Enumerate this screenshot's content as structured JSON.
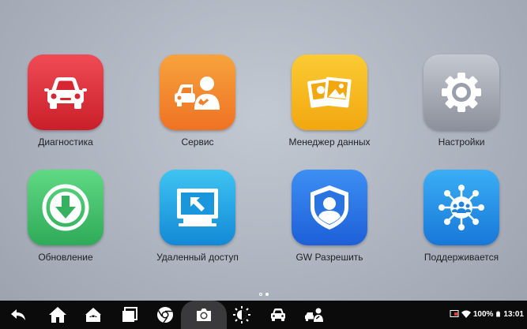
{
  "apps": [
    {
      "label": "Диагностика",
      "icon": "car-icon",
      "color": "#e8323c"
    },
    {
      "label": "Сервис",
      "icon": "car-service-person-icon",
      "color": "#f38a2e"
    },
    {
      "label": "Менеджер данных",
      "icon": "photos-icon",
      "color": "#f6b91e"
    },
    {
      "label": "Настройки",
      "icon": "gear-icon",
      "color": "#a9adb6"
    },
    {
      "label": "Обновление",
      "icon": "download-icon",
      "color": "#3fc26c"
    },
    {
      "label": "Удаленный доступ",
      "icon": "remote-desktop-icon",
      "color": "#25a8e6"
    },
    {
      "label": "GW Разрешить",
      "icon": "shield-user-icon",
      "color": "#2f7ce6"
    },
    {
      "label": "Поддерживается",
      "icon": "support-network-icon",
      "color": "#2a93e8"
    }
  ],
  "pager": {
    "pages": 2,
    "current": 2
  },
  "navbar": {
    "buttons": [
      "back-icon",
      "home-icon",
      "android-car-icon",
      "recent-apps-icon",
      "chrome-icon",
      "camera-icon",
      "brightness-icon",
      "car-icon",
      "car-service-person-icon"
    ]
  },
  "status": {
    "battery": "100%",
    "time": "13:01"
  }
}
